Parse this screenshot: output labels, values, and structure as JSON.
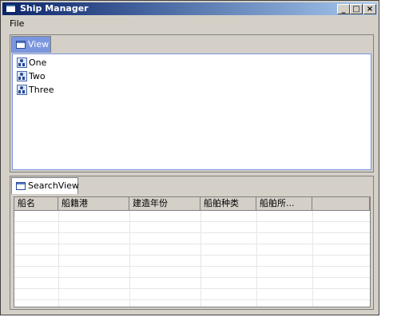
{
  "window": {
    "title": "Ship Manager"
  },
  "title_buttons": {
    "minimize": "_",
    "maximize": "□",
    "close": "×"
  },
  "menu": {
    "file": "File"
  },
  "view_pane": {
    "tab_label": "View",
    "tree_items": [
      "One",
      "Two",
      "Three"
    ]
  },
  "search_pane": {
    "tab_label": "SearchView",
    "columns": [
      "船名",
      "船籍港",
      "建造年份",
      "船舶种类",
      "船舶所...",
      ""
    ]
  },
  "colors": {
    "title_bar_start": "#0a246a",
    "title_bar_end": "#a6caf0",
    "active_tab": "#7a96df",
    "window_bg": "#d4d0c8"
  }
}
